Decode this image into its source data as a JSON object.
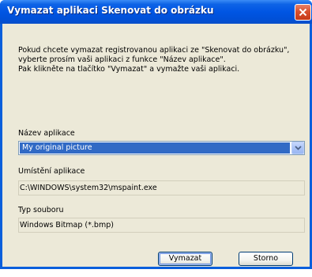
{
  "window": {
    "title": "Vymazat aplikaci Skenovat do obrázku"
  },
  "message": {
    "lines": [
      "Pokud chcete vymazat registrovanou aplikaci ze \"Skenovat do obrázku\",",
      "vyberte prosím vaši aplikaci z funkce  \"Název aplikace\".",
      "Pak klikněte na tlačítko \"Vymazat\" a vymažte vaši aplikaci."
    ]
  },
  "app_name": {
    "label": "Název aplikace",
    "selected": "My original picture"
  },
  "app_location": {
    "label": "Umístění aplikace",
    "value": "C:\\WINDOWS\\system32\\mspaint.exe"
  },
  "file_type": {
    "label": "Typ souboru",
    "value": "Windows Bitmap (*.bmp)"
  },
  "buttons": {
    "delete_label": "Vymazat",
    "cancel_label": "Storno"
  },
  "icons": {
    "close": "close-icon",
    "dropdown": "chevron-down-icon"
  },
  "colors": {
    "title_bar": "#0055e3",
    "dialog_bg": "#ece9d8",
    "selection": "#316ac5",
    "close_button": "#d8502e"
  }
}
